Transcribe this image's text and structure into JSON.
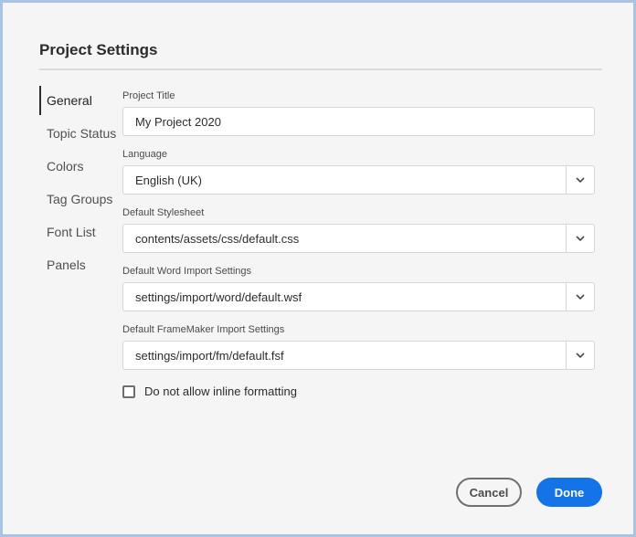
{
  "dialog": {
    "title": "Project Settings"
  },
  "nav": {
    "items": [
      {
        "label": "General"
      },
      {
        "label": "Topic Status"
      },
      {
        "label": "Colors"
      },
      {
        "label": "Tag Groups"
      },
      {
        "label": "Font List"
      },
      {
        "label": "Panels"
      }
    ],
    "active": "General"
  },
  "form": {
    "project_title": {
      "label": "Project Title",
      "value": "My Project 2020"
    },
    "language": {
      "label": "Language",
      "value": "English (UK)"
    },
    "default_stylesheet": {
      "label": "Default Stylesheet",
      "value": "contents/assets/css/default.css"
    },
    "word_import": {
      "label": "Default Word Import Settings",
      "value": "settings/import/word/default.wsf"
    },
    "framemaker_import": {
      "label": "Default FrameMaker Import Settings",
      "value": "settings/import/fm/default.fsf"
    },
    "inline_formatting": {
      "label": "Do not allow inline formatting",
      "checked": false
    }
  },
  "buttons": {
    "cancel": "Cancel",
    "done": "Done"
  },
  "colors": {
    "primary": "#1473e6",
    "background": "#f5f5f5",
    "border": "#a9c3e5"
  },
  "icons": {
    "dropdown": "chevron-down-icon"
  }
}
